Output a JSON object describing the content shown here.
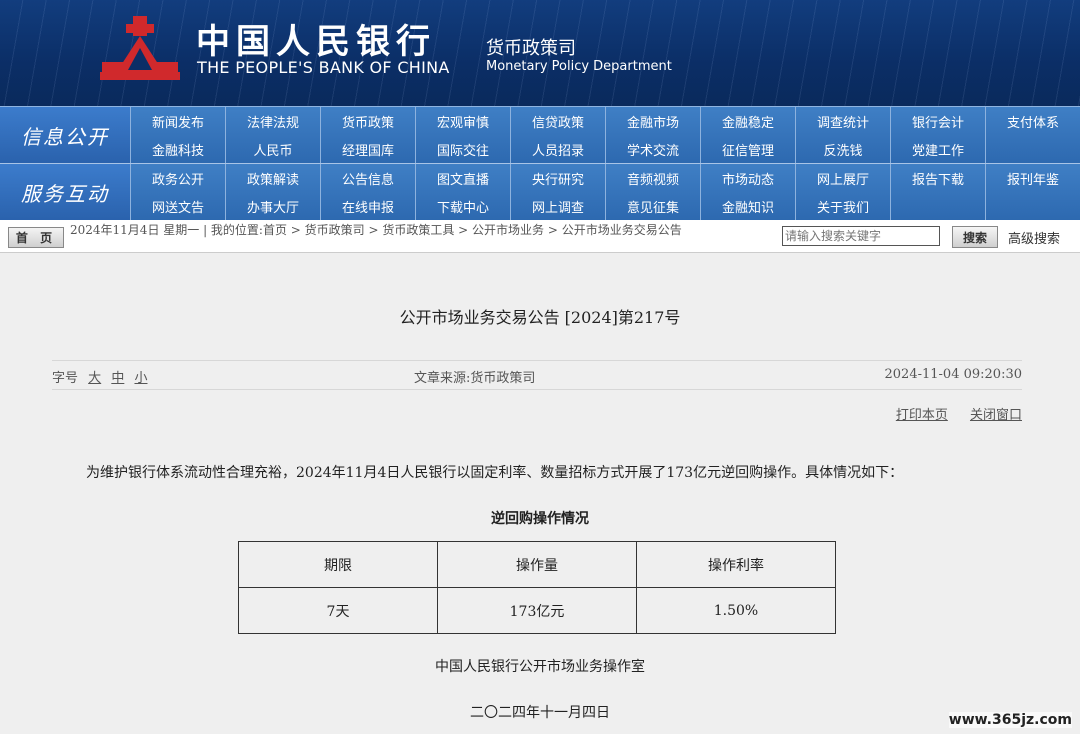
{
  "header": {
    "bank_cn": "中国人民银行",
    "bank_en": "THE PEOPLE'S BANK OF CHINA",
    "dept_cn": "货币政策司",
    "dept_en": "Monetary Policy Department",
    "logo_color": "#d0292c"
  },
  "nav": {
    "section1": "信息公开",
    "section2": "服务互动",
    "row1": [
      "新闻发布",
      "法律法规",
      "货币政策",
      "宏观审慎",
      "信贷政策",
      "金融市场",
      "金融稳定",
      "调查统计",
      "银行会计",
      "支付体系",
      "金融科技",
      "人民币",
      "经理国库",
      "国际交往",
      "人员招录",
      "学术交流",
      "征信管理",
      "反洗钱",
      "党建工作",
      ""
    ],
    "row2": [
      "政务公开",
      "政策解读",
      "公告信息",
      "图文直播",
      "央行研究",
      "音频视频",
      "市场动态",
      "网上展厅",
      "报告下载",
      "报刊年鉴",
      "网送文告",
      "办事大厅",
      "在线申报",
      "下载中心",
      "网上调查",
      "意见征集",
      "金融知识",
      "关于我们",
      "",
      ""
    ]
  },
  "breadcrumb": {
    "home_label": "首 页",
    "path": "2024年11月4日  星期一  |  我的位置:首页  >  货币政策司  >  货币政策工具  >  公开市场业务  >  公开市场业务交易公告",
    "search_placeholder": "请输入搜索关键字",
    "search_button": "搜索",
    "advanced_search": "高级搜索"
  },
  "article": {
    "title": "公开市场业务交易公告 [2024]第217号",
    "font_size_label": "字号",
    "font_sizes": [
      "大",
      "中",
      "小"
    ],
    "source": "文章来源:货币政策司",
    "datetime": "2024-11-04 09:20:30",
    "print_label": "打印本页",
    "close_label": "关闭窗口",
    "body": "为维护银行体系流动性合理充裕，2024年11月4日人民银行以固定利率、数量招标方式开展了173亿元逆回购操作。具体情况如下：",
    "table_title": "逆回购操作情况",
    "table": {
      "headers": [
        "期限",
        "操作量",
        "操作利率"
      ],
      "rows": [
        [
          "7天",
          "173亿元",
          "1.50%"
        ]
      ]
    },
    "signature": "中国人民银行公开市场业务操作室",
    "date_cn": "二〇二四年十一月四日"
  },
  "watermark": "www.365jz.com"
}
